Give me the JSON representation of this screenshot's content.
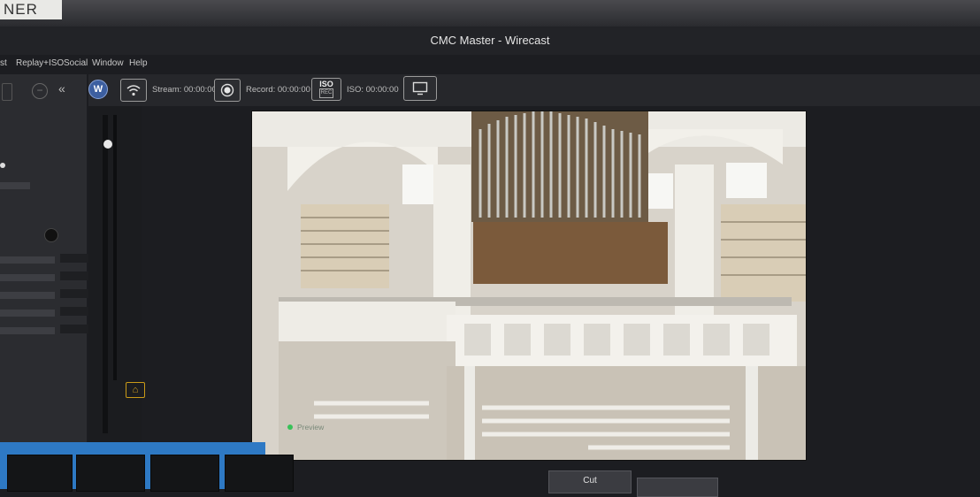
{
  "sticker": {
    "text": "NER"
  },
  "window": {
    "title": "CMC Master - Wirecast"
  },
  "menu": {
    "items": [
      "st",
      "Replay+ISO",
      "Social",
      "Window",
      "Help"
    ]
  },
  "toolbar": {
    "stream_label": "Stream: 00:00:00",
    "record_label": "Record: 00:00:00",
    "iso_label": "ISO: 00:00:00",
    "iso_button_text": "ISO",
    "iso_button_sub": "REC"
  },
  "preview": {
    "label": "Preview"
  },
  "transition": {
    "cut_label": "Cut"
  },
  "colors": {
    "background": "#1c1d21",
    "panel": "#2b2c30",
    "accent_blue": "#2e79c4",
    "status_green": "#38c158",
    "lock_amber": "#d9a31c"
  },
  "icons": [
    "wifi-icon",
    "record-icon",
    "iso-icon",
    "monitor-icon",
    "lock-icon",
    "wirecast-logo-icon",
    "collapse-icon",
    "minus-icon"
  ]
}
